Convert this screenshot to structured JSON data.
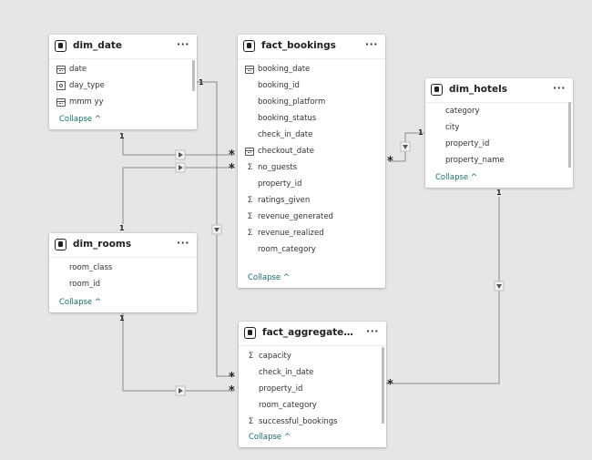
{
  "tables": {
    "dim_date": {
      "title": "dim_date",
      "fields": [
        {
          "name": "date",
          "icon": "calendar-icon"
        },
        {
          "name": "day_type",
          "icon": "hierarchy-icon"
        },
        {
          "name": "mmm yy",
          "icon": "calendar-icon"
        }
      ],
      "collapse": "Collapse ^"
    },
    "fact_bookings": {
      "title": "fact_bookings",
      "fields": [
        {
          "name": "booking_date",
          "icon": "calendar-icon"
        },
        {
          "name": "booking_id",
          "icon": ""
        },
        {
          "name": "booking_platform",
          "icon": ""
        },
        {
          "name": "booking_status",
          "icon": ""
        },
        {
          "name": "check_in_date",
          "icon": ""
        },
        {
          "name": "checkout_date",
          "icon": "calendar-icon"
        },
        {
          "name": "no_guests",
          "icon": "sum-icon"
        },
        {
          "name": "property_id",
          "icon": ""
        },
        {
          "name": "ratings_given",
          "icon": "sum-icon"
        },
        {
          "name": "revenue_generated",
          "icon": "sum-icon"
        },
        {
          "name": "revenue_realized",
          "icon": "sum-icon"
        },
        {
          "name": "room_category",
          "icon": ""
        }
      ],
      "collapse": "Collapse ^"
    },
    "dim_hotels": {
      "title": "dim_hotels",
      "fields": [
        {
          "name": "category",
          "icon": ""
        },
        {
          "name": "city",
          "icon": ""
        },
        {
          "name": "property_id",
          "icon": ""
        },
        {
          "name": "property_name",
          "icon": ""
        }
      ],
      "collapse": "Collapse ^"
    },
    "dim_rooms": {
      "title": "dim_rooms",
      "fields": [
        {
          "name": "room_class",
          "icon": ""
        },
        {
          "name": "room_id",
          "icon": ""
        }
      ],
      "collapse": "Collapse ^"
    },
    "fact_aggregated_bookings": {
      "title": "fact_aggregated_booki...",
      "fields": [
        {
          "name": "capacity",
          "icon": "sum-icon"
        },
        {
          "name": "check_in_date",
          "icon": ""
        },
        {
          "name": "property_id",
          "icon": ""
        },
        {
          "name": "room_category",
          "icon": ""
        },
        {
          "name": "successful_bookings",
          "icon": "sum-icon"
        }
      ],
      "collapse": "Collapse ^"
    }
  },
  "ui": {
    "more": "···"
  },
  "cardinality": {
    "one": "1",
    "many": "*"
  },
  "colors": {
    "line": "#8a8a8a",
    "collapse_link": "#1b6b6b",
    "background": "#e6e6e6"
  }
}
